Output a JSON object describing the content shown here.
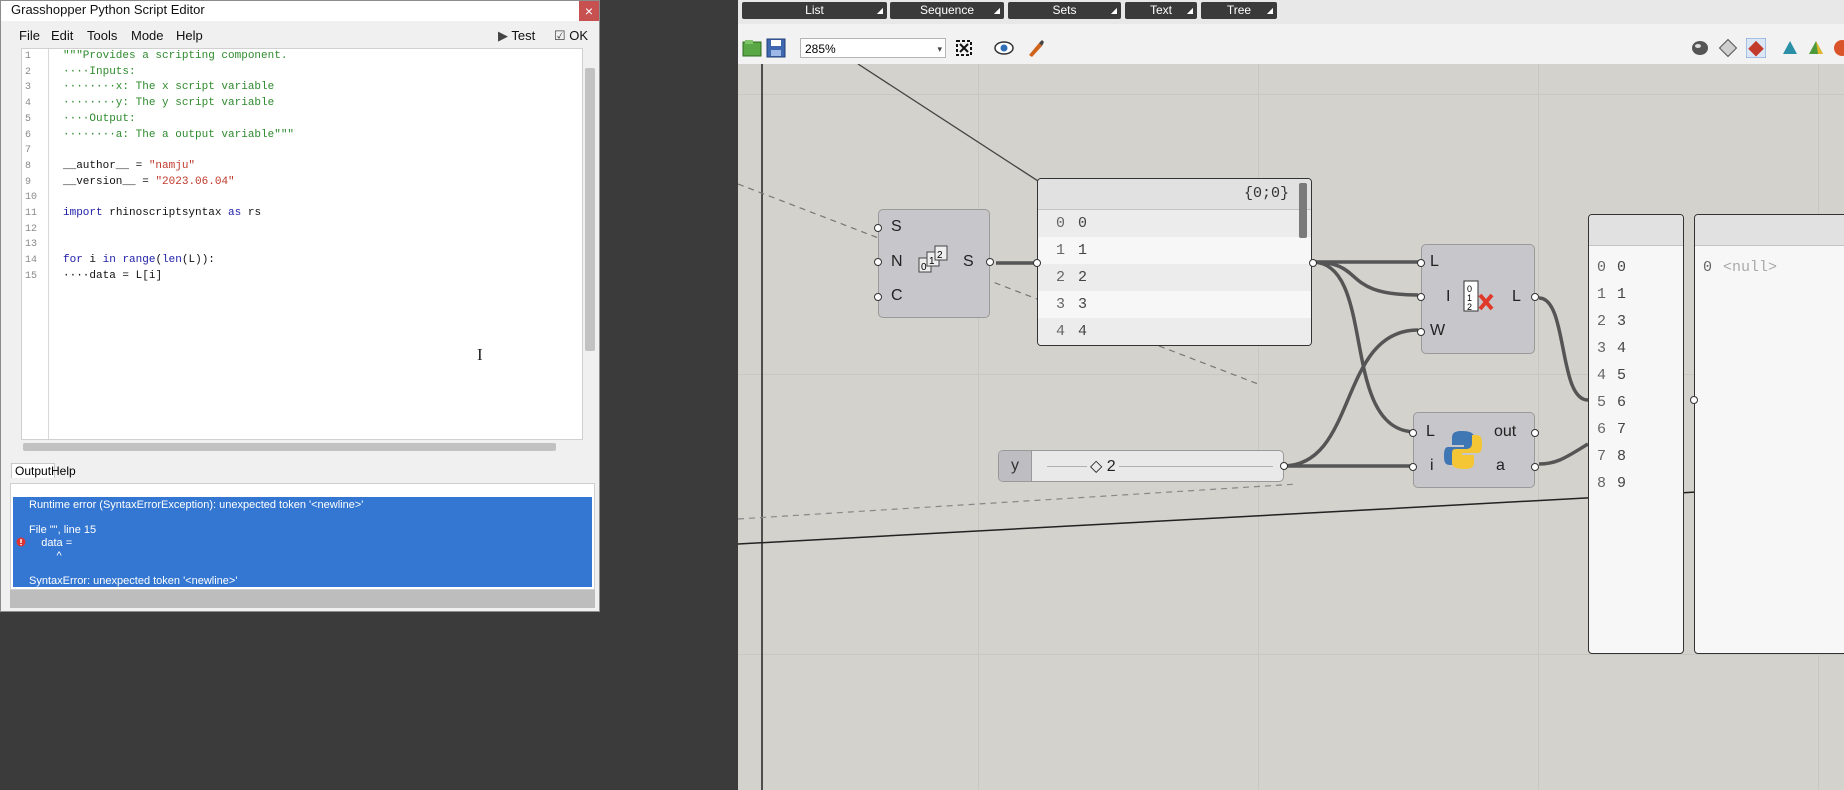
{
  "window": {
    "title": "Grasshopper Python Script Editor",
    "close_label": "×"
  },
  "menu": {
    "items": [
      "File",
      "Edit",
      "Tools",
      "Mode",
      "Help"
    ],
    "test_label": "Test",
    "ok_label": "OK"
  },
  "editor": {
    "line_numbers": [
      "1",
      "2",
      "3",
      "4",
      "5",
      "6",
      "7",
      "8",
      "9",
      "10",
      "11",
      "12",
      "13",
      "14",
      "15"
    ],
    "lines": [
      "\"\"\"Provides a scripting component.",
      "····Inputs:",
      "········x: The x script variable",
      "········y: The y script variable",
      "····Output:",
      "········a: The a output variable\"\"\"",
      "",
      "__author__ = \"namju\"",
      "__version__ = \"2023.06.04\"",
      "",
      "import rhinoscriptsyntax as rs",
      "",
      "",
      "for i in range(len(L)):",
      "····data = L[i]"
    ]
  },
  "output": {
    "tabs": [
      "Output",
      "Help"
    ],
    "lines": [
      "Runtime error (SyntaxErrorException): unexpected token '<newline>'",
      "",
      "File \"\", line 15",
      "    data =",
      "         ^",
      "",
      "SyntaxError: unexpected token '<newline>'"
    ]
  },
  "gh": {
    "tabs": [
      "List",
      "Sequence",
      "Sets",
      "Text",
      "Tree"
    ],
    "zoom": "285%",
    "series_node": {
      "inputs": [
        "S",
        "N",
        "C"
      ],
      "output": "S"
    },
    "panel1": {
      "header": "{0;0}",
      "rows": [
        [
          "0",
          "0"
        ],
        [
          "1",
          "1"
        ],
        [
          "2",
          "2"
        ],
        [
          "3",
          "3"
        ],
        [
          "4",
          "4"
        ]
      ]
    },
    "cull_node": {
      "inputs": [
        "L",
        "I",
        "W"
      ],
      "output": "L"
    },
    "slider": {
      "label": "y",
      "value": "◇ 2"
    },
    "python_node": {
      "inputs": [
        "L",
        "i"
      ],
      "outputs": [
        "out",
        "a"
      ]
    },
    "panel2": {
      "rows": [
        [
          "0",
          "0"
        ],
        [
          "1",
          "1"
        ],
        [
          "2",
          "3"
        ],
        [
          "3",
          "4"
        ],
        [
          "4",
          "5"
        ],
        [
          "5",
          "6"
        ],
        [
          "6",
          "7"
        ],
        [
          "7",
          "8"
        ],
        [
          "8",
          "9"
        ]
      ]
    },
    "panel3": {
      "rows": [
        [
          "0",
          "<null>"
        ]
      ]
    }
  }
}
